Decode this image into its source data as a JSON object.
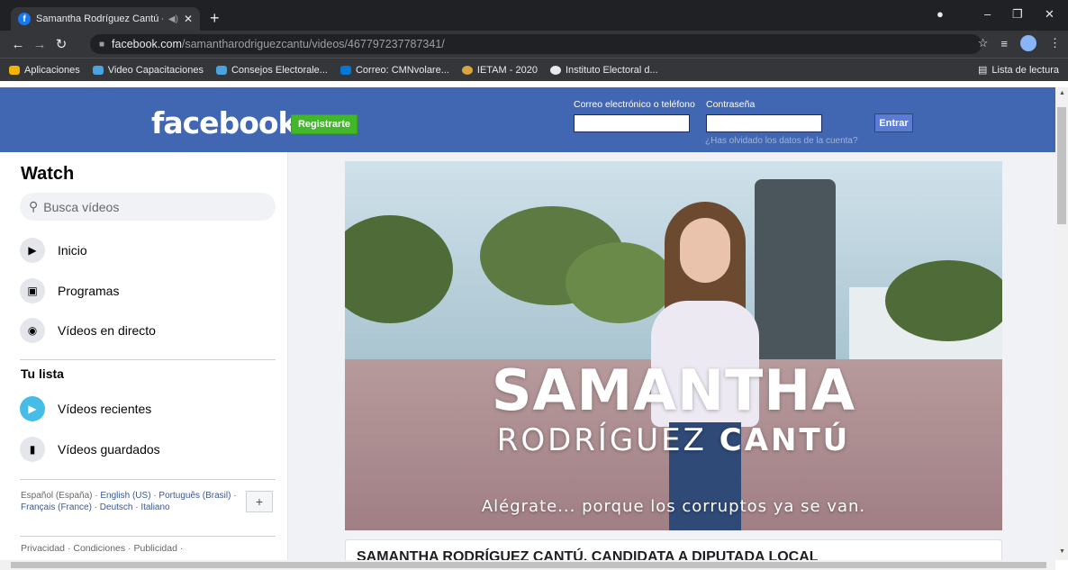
{
  "browser": {
    "tab_title": "Samantha Rodríguez Cantú -",
    "tab_audio": "◀)",
    "tab_close": "✕",
    "new_tab": "+",
    "url_host": "facebook.com",
    "url_path": "/samantharodriguezcantu/videos/467797237787341/",
    "bookmarks": [
      {
        "label": "Aplicaciones",
        "color": "#f4b400"
      },
      {
        "label": "Video Capacitaciones",
        "color": "#4aa3df"
      },
      {
        "label": "Consejos Electorale...",
        "color": "#4aa3df"
      },
      {
        "label": "Correo: CMNvolare...",
        "color": "#0078d4"
      },
      {
        "label": "IETAM - 2020",
        "color": "#d9a441"
      },
      {
        "label": "Instituto Electoral d...",
        "color": "#e8eaed"
      }
    ],
    "reading_list": "Lista de lectura"
  },
  "header": {
    "logo": "facebook",
    "register": "Registrarte",
    "email_label": "Correo electrónico o teléfono",
    "password_label": "Contraseña",
    "login": "Entrar",
    "forgot": "¿Has olvidado los datos de la cuenta?"
  },
  "sidebar": {
    "title": "Watch",
    "search_placeholder": "Busca vídeos",
    "items": [
      {
        "label": "Inicio",
        "icon": "play-screen-icon"
      },
      {
        "label": "Programas",
        "icon": "clapper-icon"
      },
      {
        "label": "Vídeos en directo",
        "icon": "live-camera-icon"
      }
    ],
    "list_title": "Tu lista",
    "list_items": [
      {
        "label": "Vídeos recientes",
        "icon": "play-icon"
      },
      {
        "label": "Vídeos guardados",
        "icon": "bookmark-icon"
      }
    ],
    "lang_current": "Español (España)",
    "langs": [
      "English (US)",
      "Português (Brasil)",
      "Français (France)",
      "Deutsch",
      "Italiano"
    ],
    "legal": "Privacidad · Condiciones · Publicidad ·"
  },
  "video": {
    "name_line1": "SAMANTHA",
    "name_line2a": "RODRÍGUEZ ",
    "name_line2b": "CANTÚ",
    "tagline": "Alégrate... porque los corruptos ya se van.",
    "caption": "SAMANTHA RODRÍGUEZ CANTÚ, CANDIDATA A DIPUTADA LOCAL"
  }
}
